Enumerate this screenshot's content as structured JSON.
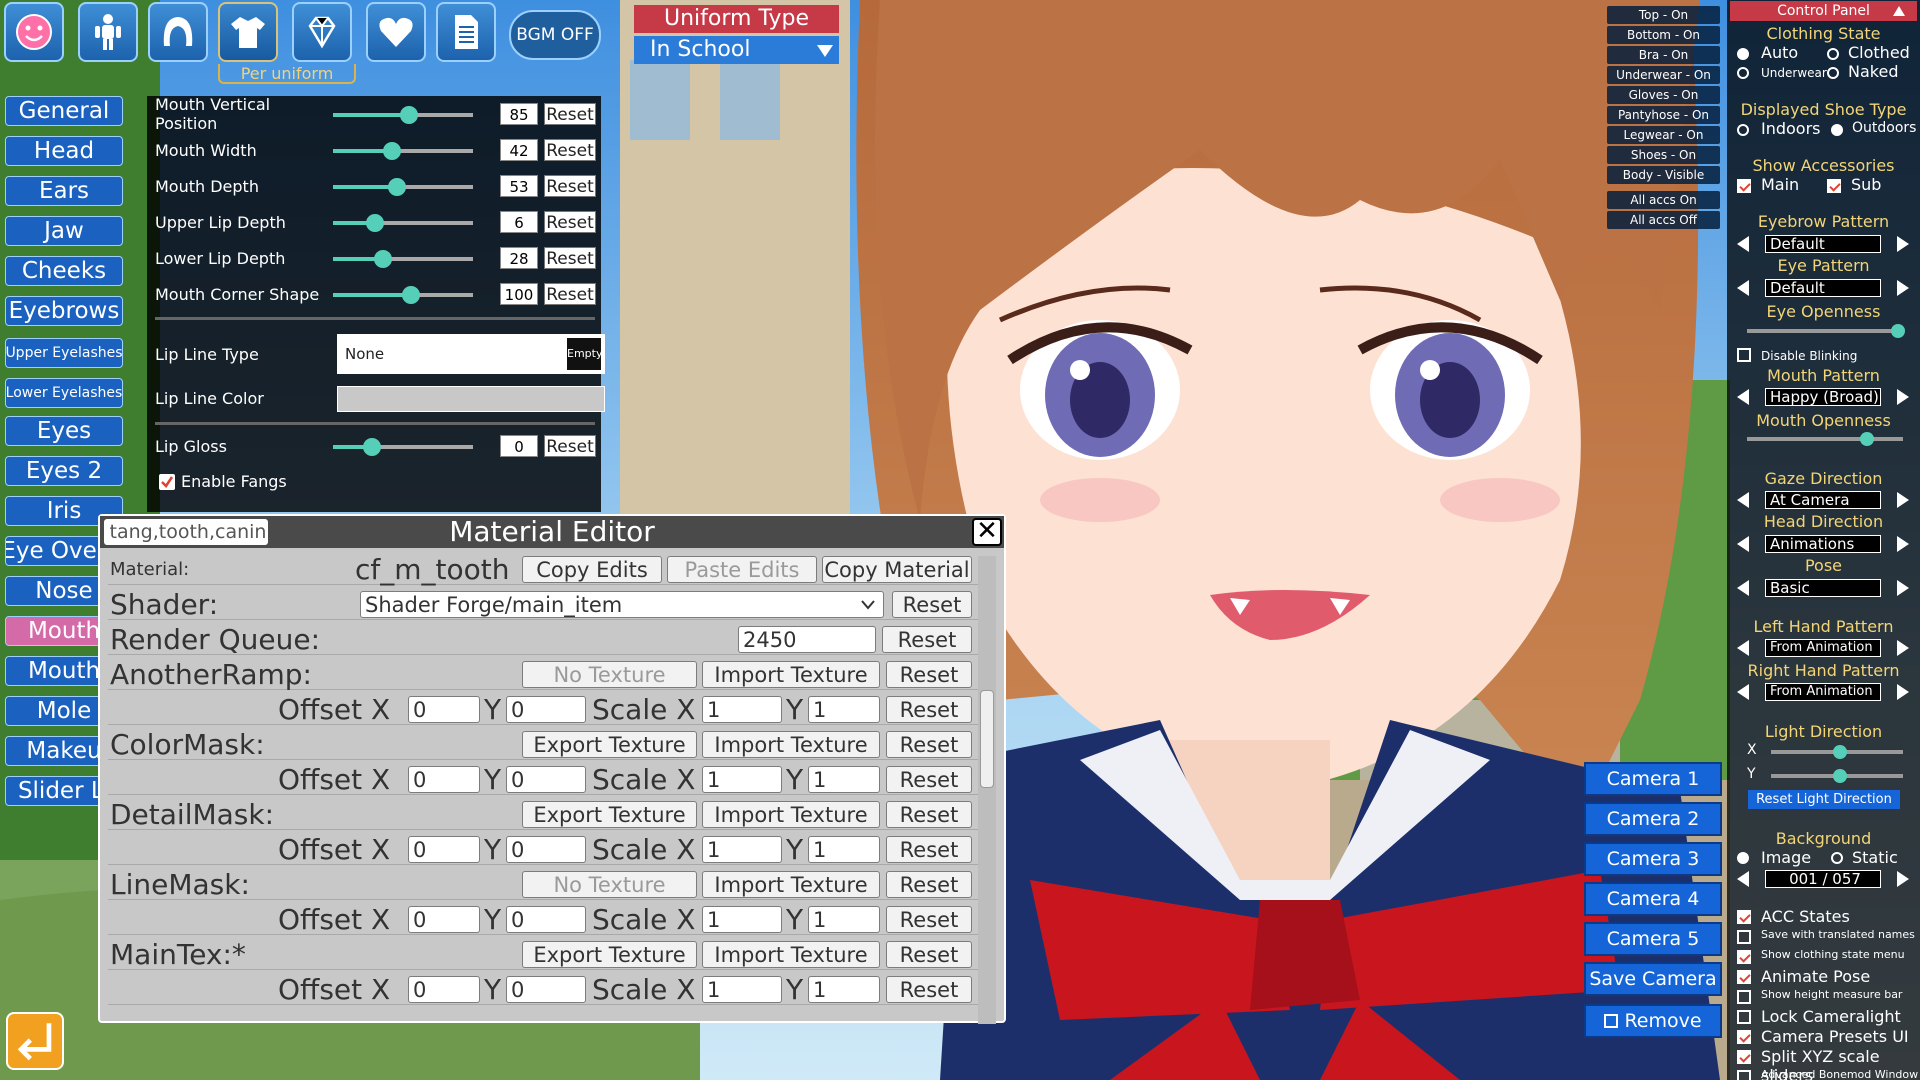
{
  "top_bar": {
    "icons": [
      "face-icon",
      "body-icon",
      "hair-icon",
      "clothing-icon",
      "accessory-icon",
      "heart-icon",
      "document-icon"
    ],
    "bgm_label": "BGM OFF",
    "per_uniform_label": "Per uniform"
  },
  "uniform": {
    "title": "Uniform Type",
    "selected": "In School"
  },
  "categories": [
    {
      "label": "General"
    },
    {
      "label": "Head"
    },
    {
      "label": "Ears"
    },
    {
      "label": "Jaw"
    },
    {
      "label": "Cheeks"
    },
    {
      "label": "Eyebrows"
    },
    {
      "label": "Upper Eyelashes"
    },
    {
      "label": "Lower Eyelashes"
    },
    {
      "label": "Eyes"
    },
    {
      "label": "Eyes 2"
    },
    {
      "label": "Iris"
    },
    {
      "label": "Eye Overla"
    },
    {
      "label": "Nose"
    },
    {
      "label": "Mouth"
    },
    {
      "label": "Mouth"
    },
    {
      "label": "Mole"
    },
    {
      "label": "Makeu"
    },
    {
      "label": "Slider Li"
    }
  ],
  "mouth_panel": {
    "sliders": [
      {
        "label": "Mouth Vertical Position",
        "value": "85",
        "fraction": 0.54
      },
      {
        "label": "Mouth Width",
        "value": "42",
        "fraction": 0.42
      },
      {
        "label": "Mouth Depth",
        "value": "53",
        "fraction": 0.46
      },
      {
        "label": "Upper Lip Depth",
        "value": "6",
        "fraction": 0.3
      },
      {
        "label": "Lower Lip Depth",
        "value": "28",
        "fraction": 0.36
      },
      {
        "label": "Mouth Corner Shape",
        "value": "100",
        "fraction": 0.56
      }
    ],
    "reset_label": "Reset",
    "lip_line_type_label": "Lip Line Type",
    "lip_line_type_value": "None",
    "empty_label": "Empty",
    "lip_line_color_label": "Lip Line Color",
    "lip_gloss": {
      "label": "Lip Gloss",
      "value": "0",
      "fraction": 0.28
    },
    "enable_fangs_label": "Enable Fangs"
  },
  "material_editor": {
    "title": "Material Editor",
    "filter_value": "tang,tooth,canin",
    "close_glyph": "✕",
    "material_label": "Material:",
    "material_name": "cf_m_tooth",
    "copy_edits": "Copy Edits",
    "paste_edits": "Paste Edits",
    "copy_material": "Copy Material",
    "shader_label": "Shader:",
    "shader_value": "Shader Forge/main_item",
    "render_queue_label": "Render Queue:",
    "render_queue_value": "2450",
    "reset": "Reset",
    "no_texture": "No Texture",
    "export_texture": "Export Texture",
    "import_texture": "Import Texture",
    "offset_label": "Offset X",
    "y_label": "Y",
    "scale_label": "Scale X",
    "textures": [
      {
        "name": "AnotherRamp:",
        "exportable": false,
        "ox": "0",
        "oy": "0",
        "sx": "1",
        "sy": "1"
      },
      {
        "name": "ColorMask:",
        "exportable": true,
        "ox": "0",
        "oy": "0",
        "sx": "1",
        "sy": "1"
      },
      {
        "name": "DetailMask:",
        "exportable": true,
        "ox": "0",
        "oy": "0",
        "sx": "1",
        "sy": "1"
      },
      {
        "name": "LineMask:",
        "exportable": false,
        "ox": "0",
        "oy": "0",
        "sx": "1",
        "sy": "1"
      },
      {
        "name": "MainTex:*",
        "exportable": true,
        "ox": "0",
        "oy": "0",
        "sx": "1",
        "sy": "1"
      }
    ]
  },
  "state_toggles": [
    "Top - On",
    "Bottom - On",
    "Bra - On",
    "Underwear - On",
    "Gloves - On",
    "Pantyhose - On",
    "Legwear - On",
    "Shoes - On",
    "Body - Visible",
    "All accs On",
    "All accs Off"
  ],
  "cameras": [
    "Camera 1",
    "Camera 2",
    "Camera 3",
    "Camera 4",
    "Camera 5",
    "Save Camera",
    "Remove"
  ],
  "control_panel": {
    "title": "Control Panel",
    "clothing_state": "Clothing State",
    "auto": "Auto",
    "clothed": "Clothed",
    "underwear": "Underwear",
    "naked": "Naked",
    "shoe_type": "Displayed Shoe Type",
    "indoors": "Indoors",
    "outdoors": "Outdoors",
    "show_accessories": "Show Accessories",
    "main": "Main",
    "sub": "Sub",
    "eyebrow_pattern": "Eyebrow Pattern",
    "eyebrow_value": "Default",
    "eye_pattern": "Eye Pattern",
    "eye_value": "Default",
    "eye_openness": "Eye Openness",
    "eye_openness_fraction": 0.97,
    "disable_blinking": "Disable Blinking",
    "mouth_pattern": "Mouth Pattern",
    "mouth_value": "Happy (Broad)",
    "mouth_openness": "Mouth Openness",
    "mouth_openness_fraction": 0.77,
    "gaze_direction": "Gaze Direction",
    "gaze_value": "At Camera",
    "head_direction": "Head Direction",
    "head_value": "Animations",
    "pose": "Pose",
    "pose_value": "Basic",
    "left_hand": "Left Hand Pattern",
    "left_hand_value": "From Animation",
    "right_hand": "Right Hand Pattern",
    "right_hand_value": "From Animation",
    "light_direction": "Light Direction",
    "x": "X",
    "y": "Y",
    "light_x_fraction": 0.52,
    "light_y_fraction": 0.52,
    "reset_light": "Reset Light Direction",
    "background": "Background",
    "image": "Image",
    "static": "Static",
    "bg_value": "001 / 057",
    "options": [
      {
        "label": "ACC States",
        "checked": true,
        "small": false
      },
      {
        "label": "Save with translated names",
        "checked": false,
        "small": true
      },
      {
        "label": "Show clothing state menu",
        "checked": true,
        "small": true
      },
      {
        "label": "Animate Pose",
        "checked": true,
        "small": false
      },
      {
        "label": "Show height measure bar",
        "checked": false,
        "small": true
      },
      {
        "label": "Lock Cameralight",
        "checked": false,
        "small": false
      },
      {
        "label": "Camera Presets UI",
        "checked": true,
        "small": false
      },
      {
        "label": "Split XYZ scale sliders",
        "checked": true,
        "small": false
      },
      {
        "label": "Advanced Bonemod Window",
        "checked": false,
        "small": true
      }
    ]
  },
  "colors": {
    "accent": "#1b62c0",
    "selected_category": "#d46aa8",
    "header_red": "#c63a48",
    "slider": "#56cfb8",
    "gold": "#f3d577"
  }
}
